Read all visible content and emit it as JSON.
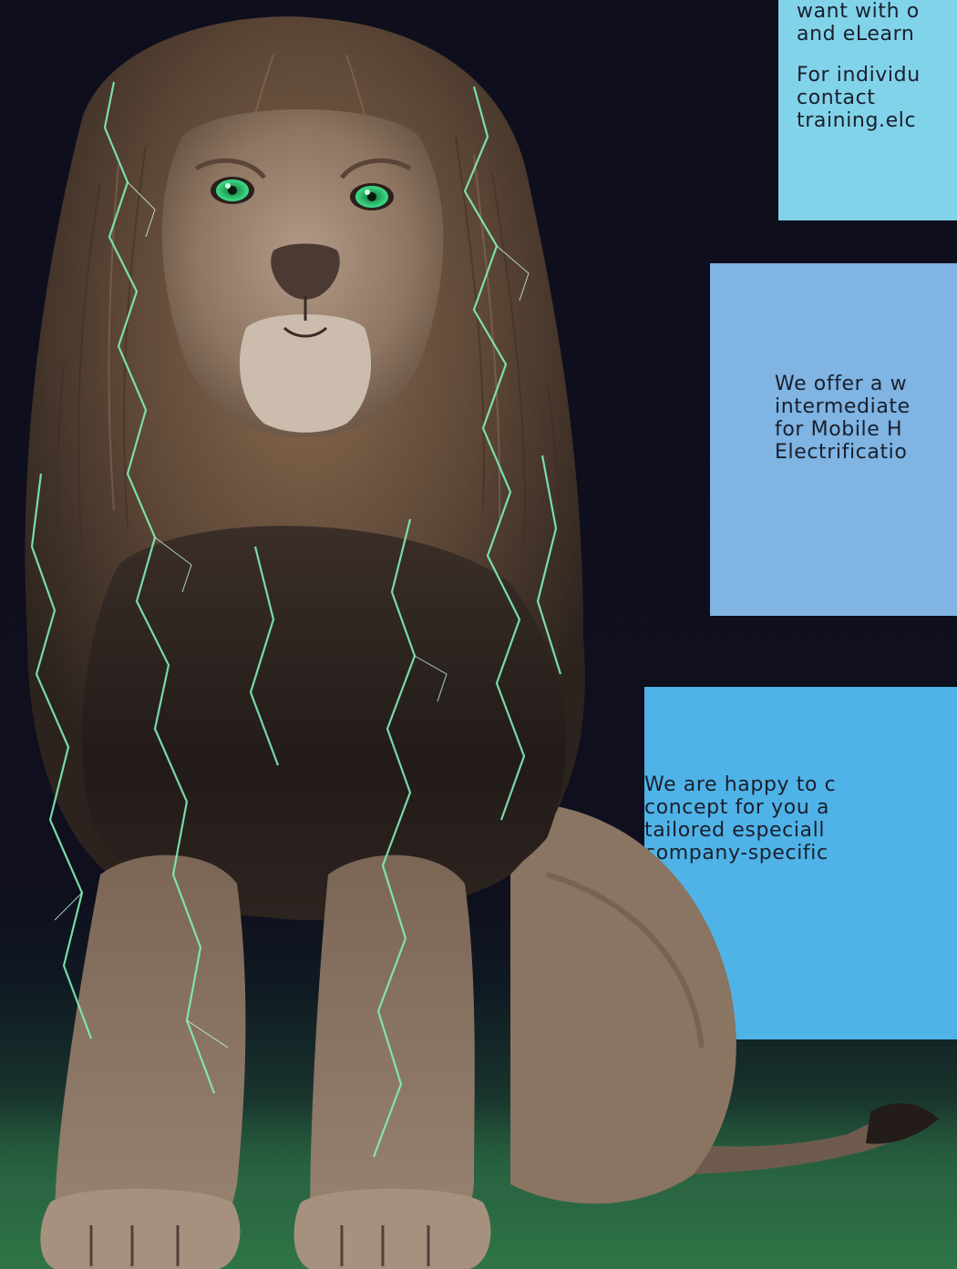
{
  "cards": {
    "top": {
      "paragraph1": "want with o\nand eLearn",
      "paragraph2": "For individu\ncontact\ntraining.elc"
    },
    "middle": {
      "text": "We offer a w\nintermediate\nfor Mobile H\nElectrificatio"
    },
    "bottom": {
      "text": "We are happy to c\nconcept for you a\ntailored especiall\ncompany-specific"
    }
  },
  "image": {
    "subject": "lion-with-green-lightning"
  },
  "colors": {
    "background": "#0f0e1c",
    "card_top": "#81d3ea",
    "card_middle": "#7fb4e3",
    "card_bottom": "#4fb3e8",
    "lightning": "#7ff0b6",
    "eyes": "#2fd47a",
    "floor": "#2e7546"
  }
}
